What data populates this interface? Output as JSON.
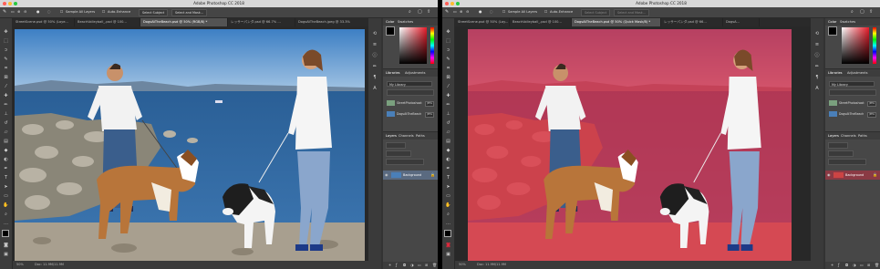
{
  "app_title": "Adobe Photoshop CC 2018",
  "options": {
    "sample_all_layers": "Sample All Layers",
    "auto_enhance": "Auto-Enhance",
    "select_subject": "Select Subject",
    "select_mask": "Select and Mask..."
  },
  "left": {
    "tabs": [
      "StreetScene.psd @ 50% (Laye...",
      "BeachVolleyball_.psd @ 100...",
      "DogsAtTheBeach.psd @ 50% (RGB/8) *",
      "レッサーパンダ.psd @ 66.7% ...",
      "DogsAtTheBeach.jpeg @ 33.3%"
    ]
  },
  "right": {
    "tabs": [
      "StreetScene.psd @ 50% (Lay...",
      "BeachVolleyball_.psd @ 100...",
      "DogsAtTheBeach.psd @ 50% (Quick Mask/8) *",
      "レッサーパンダ.psd @ 66...",
      "DogsA..."
    ]
  },
  "status": {
    "zoom": "50%",
    "doc": "Doc: 11.9M/11.9M"
  },
  "panels": {
    "color_tab": "Color",
    "swatches_tab": "Swatches",
    "libraries_tab": "Libraries",
    "adjustments_tab": "Adjustments",
    "library_select": "My Library",
    "lib_items": [
      {
        "name": "StreetPhotoshoot",
        "badge": "JPEG"
      },
      {
        "name": "DogsAtTheBeach",
        "badge": "JPEG"
      }
    ],
    "layers_tab": "Layers",
    "channels_tab": "Channels",
    "paths_tab": "Paths",
    "layer_name": "Background"
  },
  "colors": {
    "accent": "#2d8cf0",
    "quickmask": "#e6283c",
    "panel": "#474747",
    "workspace": "#282828"
  }
}
